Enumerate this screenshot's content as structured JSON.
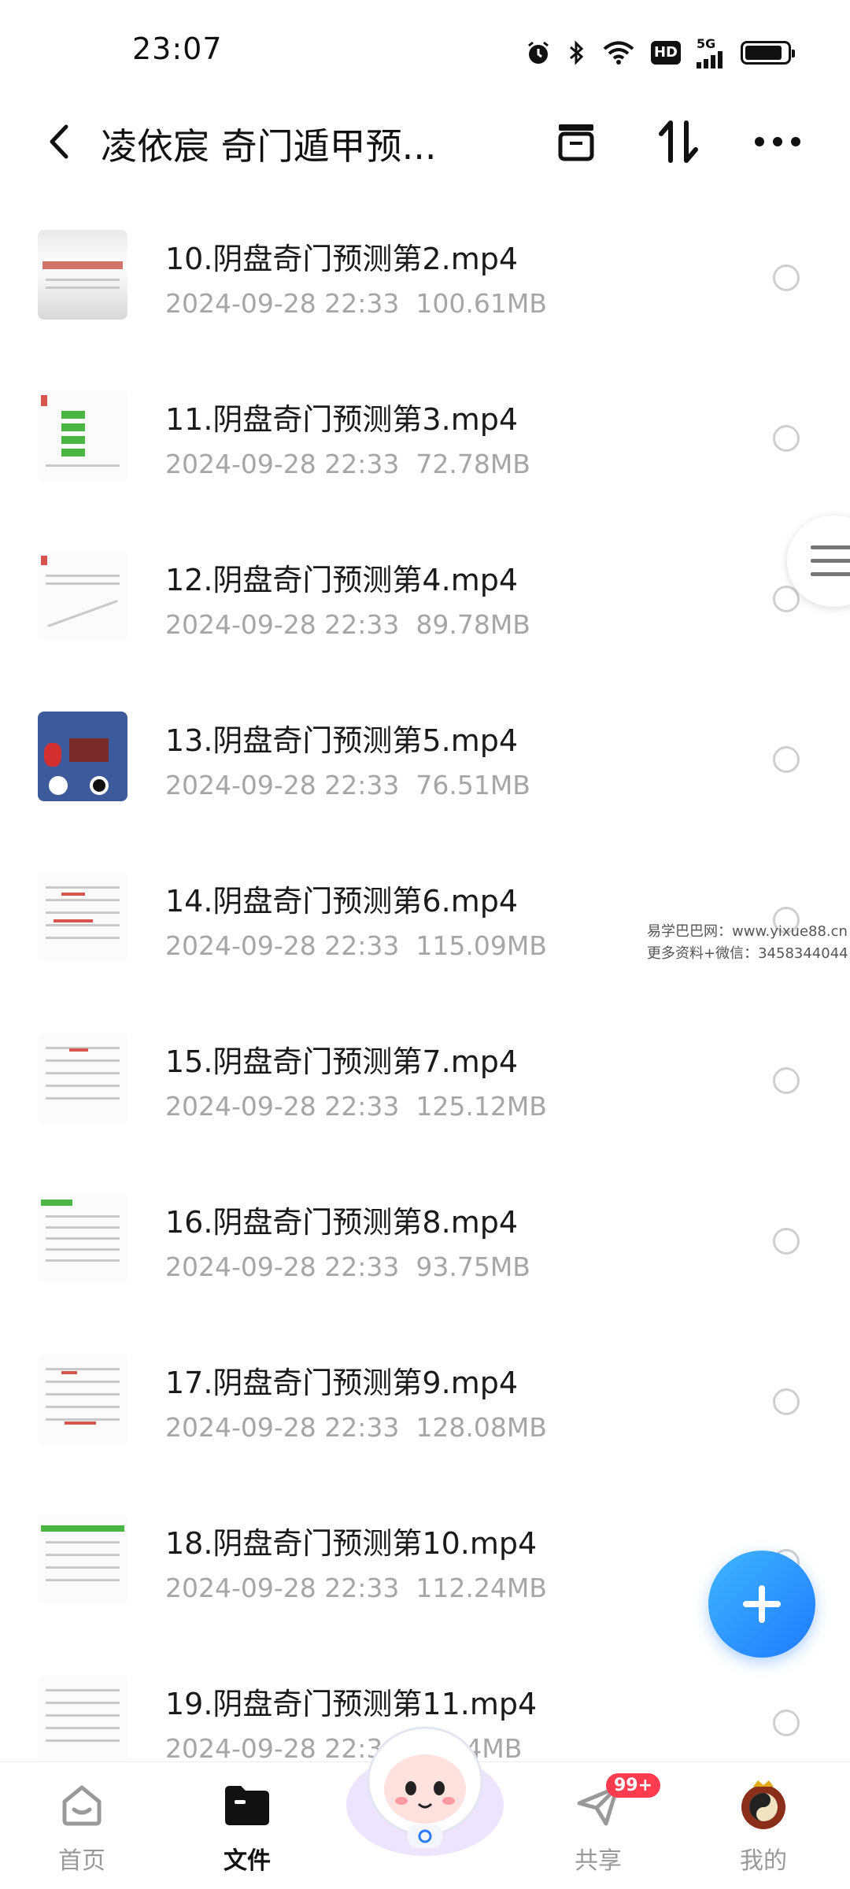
{
  "status": {
    "time": "23:07",
    "network": "5G",
    "hd": "HD"
  },
  "header": {
    "title": "凌依宸 奇门遁甲预..."
  },
  "files": [
    {
      "name": "10.阴盘奇门预测第2.mp4",
      "date": "2024-09-28  22:33",
      "size": "100.61MB"
    },
    {
      "name": "11.阴盘奇门预测第3.mp4",
      "date": "2024-09-28  22:33",
      "size": "72.78MB"
    },
    {
      "name": "12.阴盘奇门预测第4.mp4",
      "date": "2024-09-28  22:33",
      "size": "89.78MB"
    },
    {
      "name": "13.阴盘奇门预测第5.mp4",
      "date": "2024-09-28  22:33",
      "size": "76.51MB"
    },
    {
      "name": "14.阴盘奇门预测第6.mp4",
      "date": "2024-09-28  22:33",
      "size": "115.09MB"
    },
    {
      "name": "15.阴盘奇门预测第7.mp4",
      "date": "2024-09-28  22:33",
      "size": "125.12MB"
    },
    {
      "name": "16.阴盘奇门预测第8.mp4",
      "date": "2024-09-28  22:33",
      "size": "93.75MB"
    },
    {
      "name": "17.阴盘奇门预测第9.mp4",
      "date": "2024-09-28  22:33",
      "size": "128.08MB"
    },
    {
      "name": "18.阴盘奇门预测第10.mp4",
      "date": "2024-09-28  22:33",
      "size": "112.24MB"
    },
    {
      "name": "19.阴盘奇门预测第11.mp4",
      "date": "2024-09-28  22:3",
      "size": "4MB"
    }
  ],
  "watermark": {
    "line1": "易学巴巴网：www.yixue88.cn",
    "line2": "更多资料+微信：3458344044"
  },
  "nav": {
    "home": "首页",
    "files": "文件",
    "share": "共享",
    "share_badge": "99+",
    "mine": "我的"
  },
  "colors": {
    "accent": "#1e7bff",
    "badge": "#ff3b4f"
  }
}
